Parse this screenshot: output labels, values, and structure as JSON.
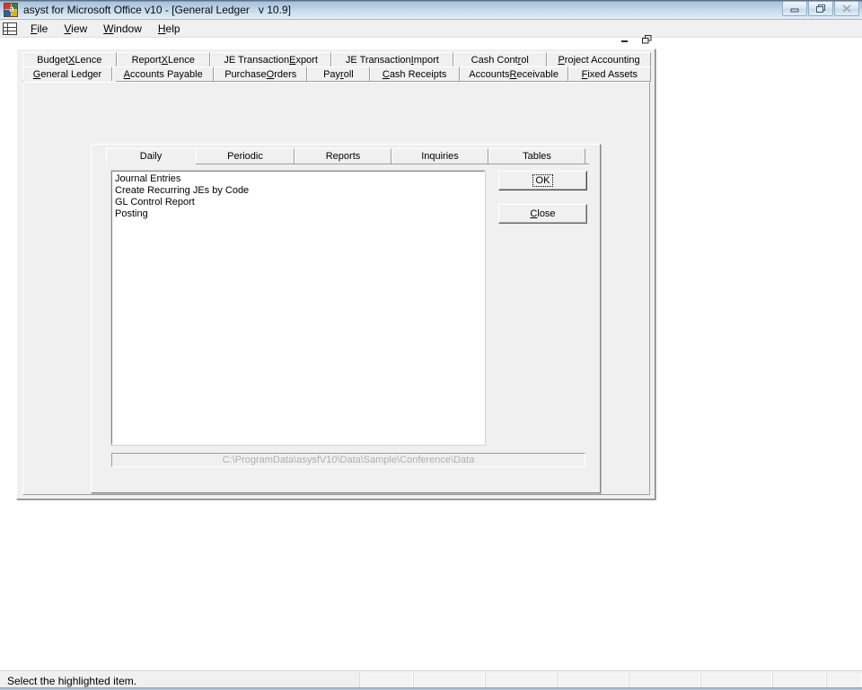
{
  "window": {
    "title": "asyst for Microsoft Office v10 - [General Ledger   v 10.9]",
    "app_icon_letter": "a",
    "buttons": {
      "minimize": "minimize-icon",
      "restore": "restore-icon",
      "close": "close-icon"
    }
  },
  "menu": {
    "system_icon": "grid-icon",
    "items": [
      {
        "label": "File",
        "pre": "",
        "acc": "F",
        "post": "ile"
      },
      {
        "label": "View",
        "pre": "",
        "acc": "V",
        "post": "iew"
      },
      {
        "label": "Window",
        "pre": "",
        "acc": "W",
        "post": "indow"
      },
      {
        "label": "Help",
        "pre": "",
        "acc": "H",
        "post": "elp"
      }
    ]
  },
  "mdi_child": {
    "controls": {
      "minimize": "minimize-icon",
      "restore": "restore-icon"
    }
  },
  "outer_tabs": {
    "row1": [
      {
        "label": "Budget XLence",
        "pre": "Budget ",
        "acc": "X",
        "post": "Lence",
        "width": 108,
        "selected": false
      },
      {
        "label": "Report XLence",
        "pre": "Report ",
        "acc": "X",
        "post": "Lence",
        "width": 108,
        "selected": false
      },
      {
        "label": "JE Transaction Export",
        "pre": "JE Transaction ",
        "acc": "E",
        "post": "xport",
        "width": 140,
        "selected": false
      },
      {
        "label": "JE Transaction Import",
        "pre": "JE Transaction ",
        "acc": "I",
        "post": "mport",
        "width": 140,
        "selected": false
      },
      {
        "label": "Cash Control",
        "pre": "Cash Cont",
        "acc": "r",
        "post": "ol",
        "width": 108,
        "selected": false
      },
      {
        "label": "Project Accounting",
        "pre": "",
        "acc": "P",
        "post": "roject Accounting",
        "width": 120,
        "selected": false
      }
    ],
    "row2": [
      {
        "label": "General Ledger",
        "pre": "",
        "acc": "G",
        "post": "eneral Ledger",
        "width": 104,
        "selected": true
      },
      {
        "label": "Accounts Payable",
        "pre": "",
        "acc": "A",
        "post": "ccounts Payable",
        "width": 118,
        "selected": false
      },
      {
        "label": "Purchase Orders",
        "pre": "Purchase ",
        "acc": "O",
        "post": "rders",
        "width": 108,
        "selected": false
      },
      {
        "label": "Payroll",
        "pre": "Pay",
        "acc": "r",
        "post": "oll",
        "width": 72,
        "selected": false
      },
      {
        "label": "Cash Receipts",
        "pre": "",
        "acc": "C",
        "post": "ash Receipts",
        "width": 104,
        "selected": false
      },
      {
        "label": "Accounts Receivable",
        "pre": "Accounts ",
        "acc": "R",
        "post": "eceivable",
        "width": 126,
        "selected": false
      },
      {
        "label": "Fixed Assets",
        "pre": "",
        "acc": "F",
        "post": "ixed Assets",
        "width": 96,
        "selected": false
      }
    ]
  },
  "inner_tabs": [
    {
      "label": "Daily",
      "width": 100,
      "selected": true
    },
    {
      "label": "Periodic",
      "width": 110,
      "selected": false
    },
    {
      "label": "Reports",
      "width": 108,
      "selected": false
    },
    {
      "label": "Inquiries",
      "width": 108,
      "selected": false
    },
    {
      "label": "Tables",
      "width": 108,
      "selected": false
    }
  ],
  "listbox": {
    "items": [
      "Journal Entries",
      "Create Recurring JEs by Code",
      "GL Control Report",
      "Posting"
    ],
    "selected_index": 0
  },
  "buttons": {
    "ok": {
      "label": "OK",
      "pre": "",
      "acc": "O",
      "post": "K",
      "focused": true
    },
    "close": {
      "label": "Close",
      "pre": "",
      "acc": "C",
      "post": "lose",
      "focused": false
    }
  },
  "path_field": {
    "value": "C:\\ProgramData\\asysfV10\\Data\\Sample\\Conference\\Data"
  },
  "statusbar": {
    "message": "Select the highlighted item.",
    "panels": [
      60,
      80,
      80,
      80,
      80,
      80,
      60,
      40
    ],
    "grip": "resize-grip-icon"
  },
  "colors": {
    "face": "#f0f0f0",
    "title_gradient_top": "#5d6f85",
    "title_gradient_bottom": "#e9f1f8",
    "window_white": "#ffffff",
    "border_dark": "#848484",
    "path_text": "#b0b0b0"
  }
}
